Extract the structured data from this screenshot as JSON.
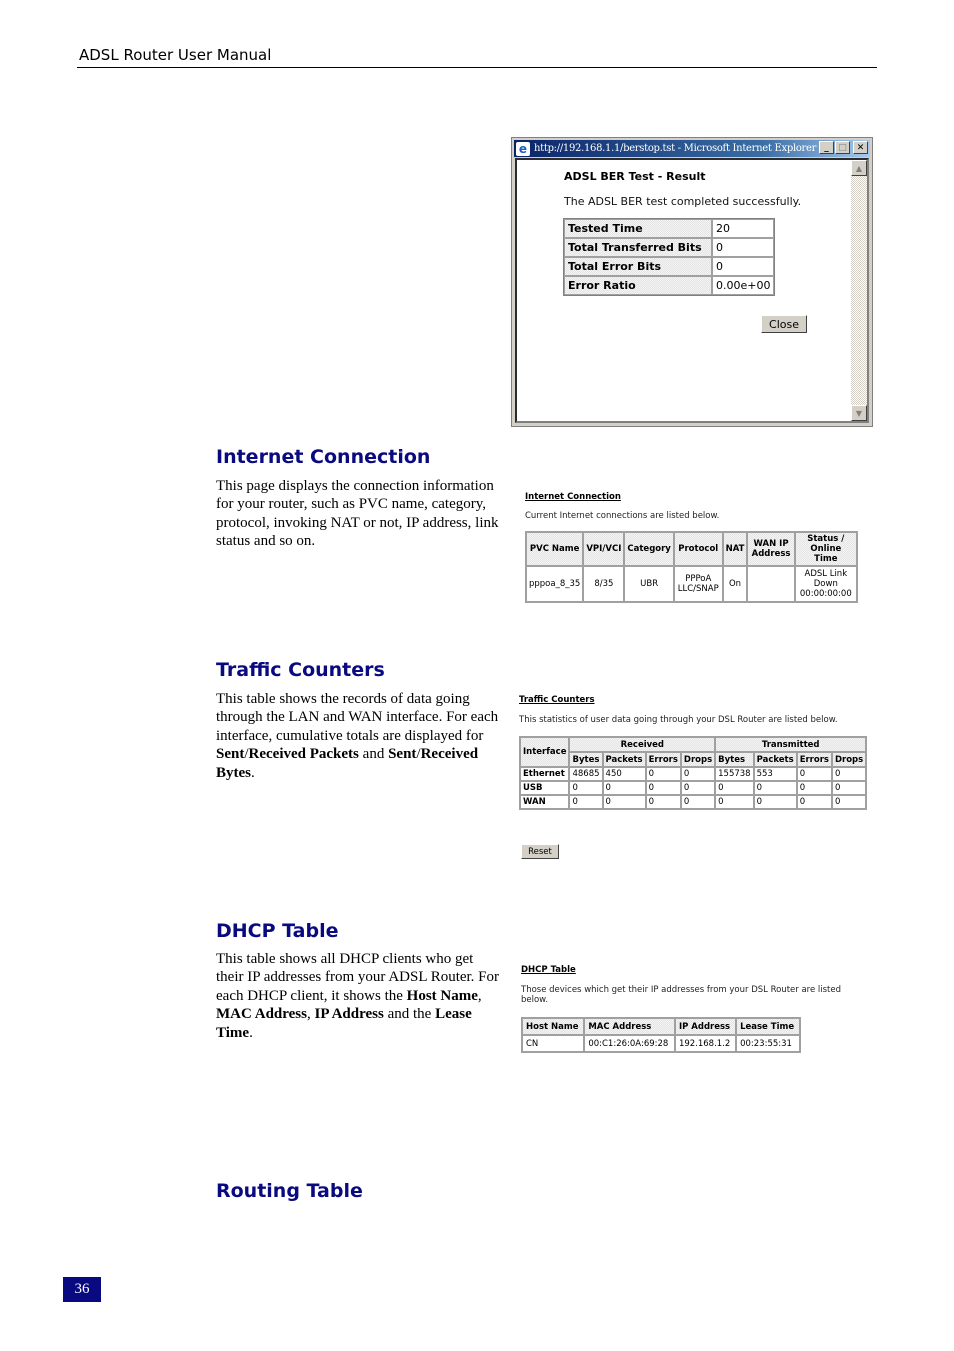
{
  "header": {
    "title": "ADSL Router User Manual"
  },
  "ber_window": {
    "window_title": "http://192.168.1.1/berstop.tst - Microsoft Internet Explorer",
    "icons": {
      "app": "ie-logo-icon",
      "minimize": "minimize-icon",
      "maximize": "maximize-icon",
      "close": "close-icon"
    },
    "heading": "ADSL BER Test - Result",
    "message": "The ADSL BER test completed successfully.",
    "rows": [
      {
        "label": "Tested Time",
        "value": "20"
      },
      {
        "label": "Total Transferred Bits",
        "value": "0"
      },
      {
        "label": "Total Error Bits",
        "value": "0"
      },
      {
        "label": "Error Ratio",
        "value": "0.00e+00"
      }
    ],
    "close_label": "Close"
  },
  "sections": {
    "internet_connection": {
      "title": "Internet Connection",
      "body": "This page displays the connection information for your router, such as PVC name, category, protocol, invoking NAT or not, IP address, link status and so on."
    },
    "traffic_counters": {
      "title": "Traffic Counters",
      "body_parts": [
        "This table shows the records of data going through the LAN and WAN interface. For each interface, cumulative totals are displayed for ",
        "Sent",
        "/",
        "Received Packets",
        " and ",
        "Sent",
        "/",
        "Received Bytes",
        "."
      ]
    },
    "dhcp_table": {
      "title": "DHCP Table",
      "body_parts": [
        "This table shows all DHCP clients who get their IP addresses from your ADSL Router. For each DHCP client, it shows the ",
        "Host Name",
        ", ",
        "MAC Address",
        ", ",
        "IP Address",
        " and the ",
        "Lease Time",
        "."
      ]
    },
    "routing_table": {
      "title": "Routing Table"
    }
  },
  "internet_connection_shot": {
    "title": "Internet Connection",
    "description": "Current Internet connections are listed below.",
    "columns": [
      "PVC Name",
      "VPI/VCI",
      "Category",
      "Protocol",
      "NAT",
      "WAN IP Address",
      "Status / Online Time"
    ],
    "rows": [
      [
        "pppoa_8_35",
        "8/35",
        "UBR",
        "PPPoA LLC/SNAP",
        "On",
        "",
        "ADSL Link Down 00:00:00:00"
      ]
    ]
  },
  "traffic_counters_shot": {
    "title": "Traffic Counters",
    "description": "This statistics of user data going through your DSL Router are listed below.",
    "interface_header": "Interface",
    "groups": [
      "Received",
      "Transmitted"
    ],
    "sub_columns": [
      "Bytes",
      "Packets",
      "Errors",
      "Drops",
      "Bytes",
      "Packets",
      "Errors",
      "Drops"
    ],
    "rows": [
      [
        "Ethernet",
        "48685",
        "450",
        "0",
        "0",
        "155738",
        "553",
        "0",
        "0"
      ],
      [
        "USB",
        "0",
        "0",
        "0",
        "0",
        "0",
        "0",
        "0",
        "0"
      ],
      [
        "WAN",
        "0",
        "0",
        "0",
        "0",
        "0",
        "0",
        "0",
        "0"
      ]
    ],
    "reset_label": "Reset"
  },
  "dhcp_shot": {
    "title": "DHCP Table",
    "description_line1": "Those devices which get their IP addresses from your DSL Router are listed",
    "description_line2": "below.",
    "columns": [
      "Host Name",
      "MAC Address",
      "IP Address",
      "Lease Time"
    ],
    "rows": [
      [
        "CN",
        "00:C1:26:0A:69:28",
        "192.168.1.2",
        "00:23:55:31"
      ]
    ]
  },
  "footer": {
    "page_number": "36"
  }
}
